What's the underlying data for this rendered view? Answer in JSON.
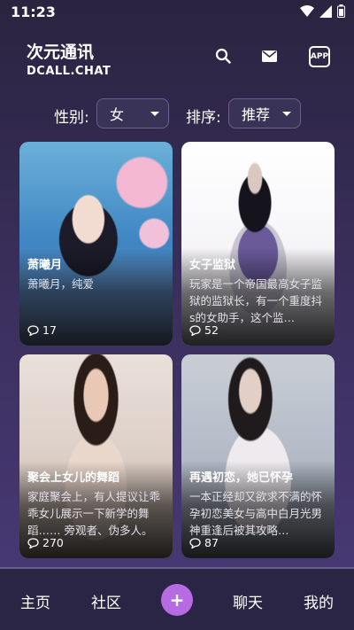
{
  "status": {
    "time": "11:23"
  },
  "header": {
    "title": "次元通讯",
    "subtitle": "DCALL.CHAT",
    "app_badge": "APP"
  },
  "filters": {
    "gender_label": "性别:",
    "gender_value": "女",
    "sort_label": "排序:",
    "sort_value": "推荐"
  },
  "cards": [
    {
      "title": "萧曦月",
      "desc": "萧曦月，纯爱",
      "count": "17"
    },
    {
      "title": "女子监狱",
      "desc": "玩家是一个帝国最高女子监狱的监狱长，有一个重度抖s的女助手，这个监…",
      "count": "52"
    },
    {
      "title": "聚会上女儿的舞蹈",
      "desc": "家庭聚会上，有人提议让乖乖女儿展示一下新学的舞蹈…… 旁观者、伪多人。",
      "count": "270"
    },
    {
      "title": "再遇初恋，她已怀孕",
      "desc": "一本正经却又欲求不满的怀孕初恋美女与高中白月光男神重逢后被其攻略…",
      "count": "87"
    }
  ],
  "tabs": {
    "home": "主页",
    "community": "社区",
    "add": "+",
    "chat": "聊天",
    "me": "我的"
  }
}
